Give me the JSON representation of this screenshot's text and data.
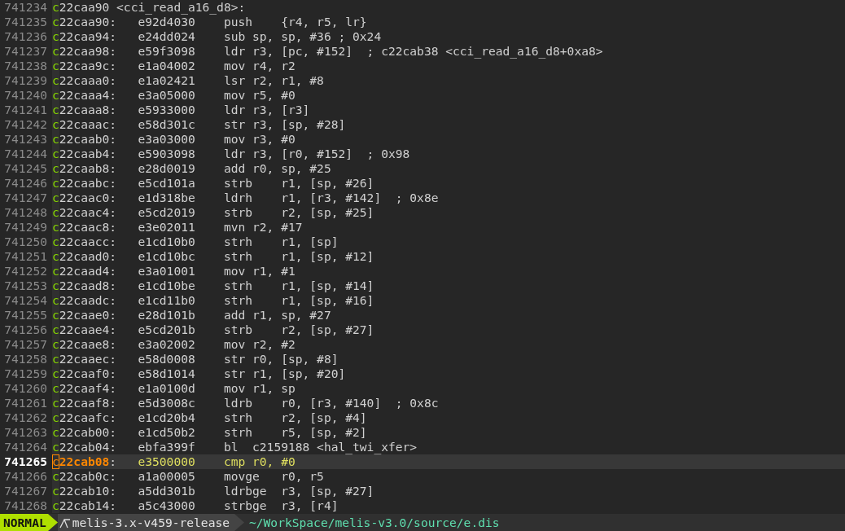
{
  "editor": {
    "lines": [
      {
        "number": "741234",
        "text": "c22caa90 <cci_read_a16_d8>:",
        "current": false
      },
      {
        "number": "741235",
        "text": "c22caa90:   e92d4030    push    {r4, r5, lr}",
        "current": false
      },
      {
        "number": "741236",
        "text": "c22caa94:   e24dd024    sub sp, sp, #36 ; 0x24",
        "current": false
      },
      {
        "number": "741237",
        "text": "c22caa98:   e59f3098    ldr r3, [pc, #152]  ; c22cab38 <cci_read_a16_d8+0xa8>",
        "current": false
      },
      {
        "number": "741238",
        "text": "c22caa9c:   e1a04002    mov r4, r2",
        "current": false
      },
      {
        "number": "741239",
        "text": "c22caaa0:   e1a02421    lsr r2, r1, #8",
        "current": false
      },
      {
        "number": "741240",
        "text": "c22caaa4:   e3a05000    mov r5, #0",
        "current": false
      },
      {
        "number": "741241",
        "text": "c22caaa8:   e5933000    ldr r3, [r3]",
        "current": false
      },
      {
        "number": "741242",
        "text": "c22caaac:   e58d301c    str r3, [sp, #28]",
        "current": false
      },
      {
        "number": "741243",
        "text": "c22caab0:   e3a03000    mov r3, #0",
        "current": false
      },
      {
        "number": "741244",
        "text": "c22caab4:   e5903098    ldr r3, [r0, #152]  ; 0x98",
        "current": false
      },
      {
        "number": "741245",
        "text": "c22caab8:   e28d0019    add r0, sp, #25",
        "current": false
      },
      {
        "number": "741246",
        "text": "c22caabc:   e5cd101a    strb    r1, [sp, #26]",
        "current": false
      },
      {
        "number": "741247",
        "text": "c22caac0:   e1d318be    ldrh    r1, [r3, #142]  ; 0x8e",
        "current": false
      },
      {
        "number": "741248",
        "text": "c22caac4:   e5cd2019    strb    r2, [sp, #25]",
        "current": false
      },
      {
        "number": "741249",
        "text": "c22caac8:   e3e02011    mvn r2, #17",
        "current": false
      },
      {
        "number": "741250",
        "text": "c22caacc:   e1cd10b0    strh    r1, [sp]",
        "current": false
      },
      {
        "number": "741251",
        "text": "c22caad0:   e1cd10bc    strh    r1, [sp, #12]",
        "current": false
      },
      {
        "number": "741252",
        "text": "c22caad4:   e3a01001    mov r1, #1",
        "current": false
      },
      {
        "number": "741253",
        "text": "c22caad8:   e1cd10be    strh    r1, [sp, #14]",
        "current": false
      },
      {
        "number": "741254",
        "text": "c22caadc:   e1cd11b0    strh    r1, [sp, #16]",
        "current": false
      },
      {
        "number": "741255",
        "text": "c22caae0:   e28d101b    add r1, sp, #27",
        "current": false
      },
      {
        "number": "741256",
        "text": "c22caae4:   e5cd201b    strb    r2, [sp, #27]",
        "current": false
      },
      {
        "number": "741257",
        "text": "c22caae8:   e3a02002    mov r2, #2",
        "current": false
      },
      {
        "number": "741258",
        "text": "c22caaec:   e58d0008    str r0, [sp, #8]",
        "current": false
      },
      {
        "number": "741259",
        "text": "c22caaf0:   e58d1014    str r1, [sp, #20]",
        "current": false
      },
      {
        "number": "741260",
        "text": "c22caaf4:   e1a0100d    mov r1, sp",
        "current": false
      },
      {
        "number": "741261",
        "text": "c22caaf8:   e5d3008c    ldrb    r0, [r3, #140]  ; 0x8c",
        "current": false
      },
      {
        "number": "741262",
        "text": "c22caafc:   e1cd20b4    strh    r2, [sp, #4]",
        "current": false
      },
      {
        "number": "741263",
        "text": "c22cab00:   e1cd50b2    strh    r5, [sp, #2]",
        "current": false
      },
      {
        "number": "741264",
        "text": "c22cab04:   ebfa399f    bl  c2159188 <hal_twi_xfer>",
        "current": false
      },
      {
        "number": "741265",
        "text": "c22cab08:   e3500000    cmp r0, #0",
        "current": true
      },
      {
        "number": "741266",
        "text": "c22cab0c:   a1a00005    movge   r0, r5",
        "current": false
      },
      {
        "number": "741267",
        "text": "c22cab10:   a5dd301b    ldrbge  r3, [sp, #27]",
        "current": false
      },
      {
        "number": "741268",
        "text": "c22cab14:   a5c43000    strbge  r3, [r4]",
        "current": false
      }
    ]
  },
  "status_bar": {
    "mode": "NORMAL",
    "branch": "melis-3.x-v459-release",
    "file": "~/WorkSpace/melis-v3.0/source/e.dis"
  }
}
